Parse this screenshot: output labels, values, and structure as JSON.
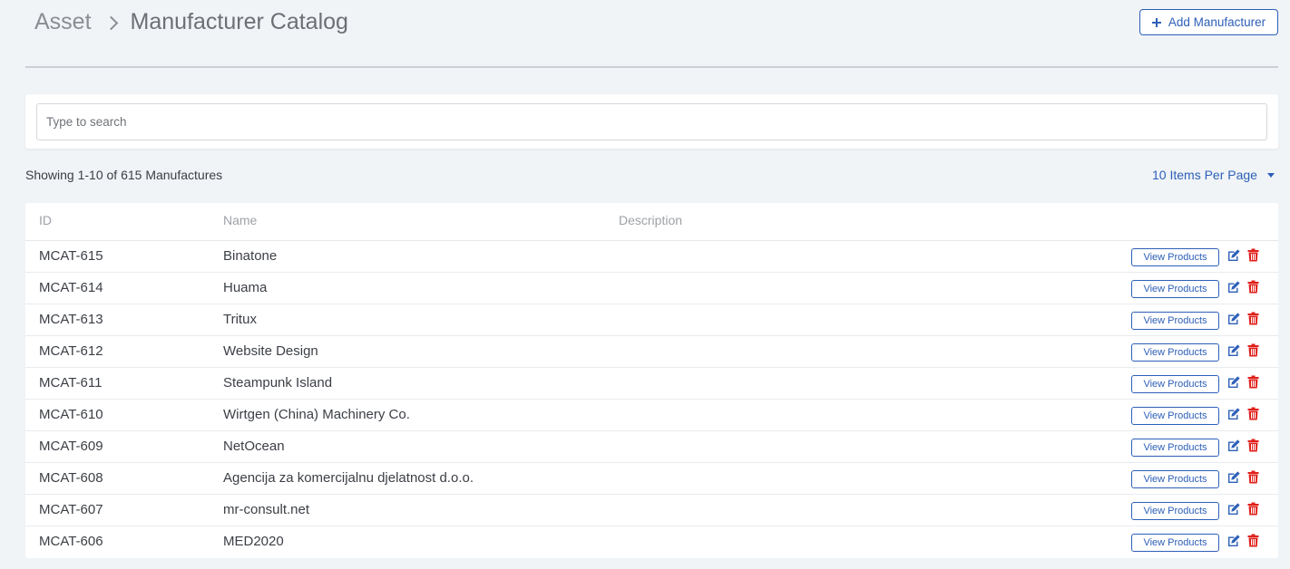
{
  "breadcrumb": {
    "root": "Asset",
    "current": "Manufacturer Catalog"
  },
  "actions": {
    "add_label": "Add Manufacturer"
  },
  "search": {
    "placeholder": "Type to search",
    "value": ""
  },
  "listing": {
    "summary": "Showing 1-10 of 615 Manufactures",
    "per_page": "10 Items Per Page"
  },
  "table": {
    "headers": {
      "id": "ID",
      "name": "Name",
      "description": "Description"
    },
    "view_label": "View Products",
    "rows": [
      {
        "id": "MCAT-615",
        "name": "Binatone",
        "description": ""
      },
      {
        "id": "MCAT-614",
        "name": "Huama",
        "description": ""
      },
      {
        "id": "MCAT-613",
        "name": "Tritux",
        "description": ""
      },
      {
        "id": "MCAT-612",
        "name": "Website Design",
        "description": ""
      },
      {
        "id": "MCAT-611",
        "name": "Steampunk Island",
        "description": ""
      },
      {
        "id": "MCAT-610",
        "name": "Wirtgen (China) Machinery Co.",
        "description": ""
      },
      {
        "id": "MCAT-609",
        "name": "NetOcean",
        "description": ""
      },
      {
        "id": "MCAT-608",
        "name": "Agencija za komercijalnu djelatnost d.o.o.",
        "description": ""
      },
      {
        "id": "MCAT-607",
        "name": "mr-consult.net",
        "description": ""
      },
      {
        "id": "MCAT-606",
        "name": "MED2020",
        "description": ""
      }
    ]
  },
  "colors": {
    "accent": "#2d5fb8",
    "danger": "#e0201b",
    "background": "#f0f4f7"
  },
  "icons": {
    "add": "plus-icon",
    "breadcrumb_separator": "chevron-right-icon",
    "per_page": "caret-down-icon",
    "edit": "edit-icon",
    "delete": "trash-icon"
  }
}
